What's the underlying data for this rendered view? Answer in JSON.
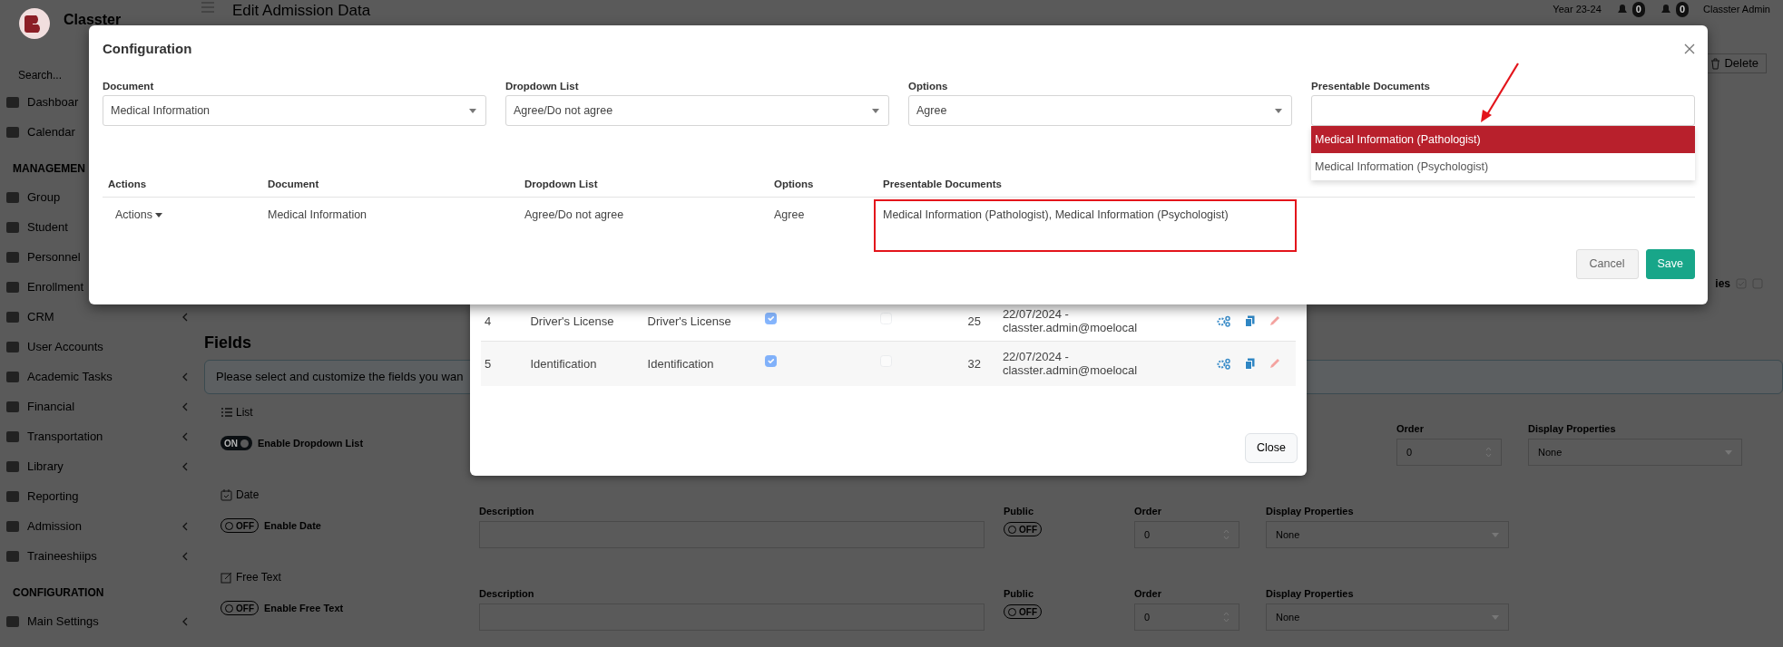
{
  "app": {
    "logo_text": "Classter",
    "search_placeholder": "Search...",
    "page_title": "Edit Admission Data",
    "year": "Year 23-24",
    "notification_counts": [
      "0",
      "0"
    ],
    "user": "Classter Admin",
    "delete_label": "Delete",
    "cut_label": "ies"
  },
  "sidebar": {
    "items": [
      {
        "kind": "item",
        "label": "Dashboar",
        "submenu": false
      },
      {
        "kind": "item",
        "label": "Calendar",
        "submenu": false
      },
      {
        "kind": "heading",
        "label": "MANAGEMEN"
      },
      {
        "kind": "item",
        "label": "Group",
        "submenu": false
      },
      {
        "kind": "item",
        "label": "Student",
        "submenu": false
      },
      {
        "kind": "item",
        "label": "Personnel",
        "submenu": false
      },
      {
        "kind": "item",
        "label": "Enrollment",
        "submenu": false
      },
      {
        "kind": "item",
        "label": "CRM",
        "submenu": true
      },
      {
        "kind": "item",
        "label": "User Accounts",
        "submenu": false
      },
      {
        "kind": "item",
        "label": "Academic Tasks",
        "submenu": true
      },
      {
        "kind": "item",
        "label": "Financial",
        "submenu": true
      },
      {
        "kind": "item",
        "label": "Transportation",
        "submenu": true
      },
      {
        "kind": "item",
        "label": "Library",
        "submenu": true
      },
      {
        "kind": "item",
        "label": "Reporting",
        "submenu": false
      },
      {
        "kind": "item",
        "label": "Admission",
        "submenu": true
      },
      {
        "kind": "item",
        "label": "Traineeshiips",
        "submenu": true
      },
      {
        "kind": "heading",
        "label": "CONFIGURATION"
      },
      {
        "kind": "item",
        "label": "Main Settings",
        "submenu": true
      }
    ]
  },
  "fields_page": {
    "title": "Fields",
    "notice": "Please select and customize the fields you wan",
    "sections": [
      {
        "kind": "list",
        "title": "List",
        "toggle_on": true,
        "toggle_text": "ON",
        "toggle_label": "Enable Dropdown List",
        "order_label": "Order",
        "order_value": "0",
        "display_label": "Display Properties",
        "display_value": "None"
      },
      {
        "kind": "date",
        "title": "Date",
        "toggle_on": false,
        "toggle_text": "OFF",
        "toggle_label": "Enable Date",
        "description_label": "Description",
        "public_label": "Public",
        "public_on": false,
        "public_text": "OFF",
        "order_label": "Order",
        "order_value": "0",
        "display_label": "Display Properties",
        "display_value": "None"
      },
      {
        "kind": "text",
        "title": "Free Text",
        "toggle_on": false,
        "toggle_text": "OFF",
        "toggle_label": "Enable Free Text",
        "description_label": "Description",
        "public_label": "Public",
        "public_on": false,
        "public_text": "OFF",
        "order_label": "Order",
        "order_value": "0",
        "display_label": "Display Properties",
        "display_value": "None"
      }
    ]
  },
  "documents_modal": {
    "rows": [
      {
        "column_1": "4",
        "column_2": "Driver's License",
        "column_3": "Driver's License",
        "column_4_checked": true,
        "column_5_checked": false,
        "column_6": "25",
        "column_7": "22/07/2024 - classter.admin@moelocal"
      },
      {
        "column_1": "5",
        "column_2": "Identification",
        "column_3": "Identification",
        "column_4_checked": true,
        "column_5_checked": false,
        "column_6": "32",
        "column_7": "22/07/2024 - classter.admin@moelocal"
      }
    ],
    "close_label": "Close"
  },
  "configuration_modal": {
    "title": "Configuration",
    "fields": [
      {
        "label": "Document",
        "value": "Medical Information",
        "open": false
      },
      {
        "label": "Dropdown List",
        "value": "Agree/Do not agree",
        "open": false
      },
      {
        "label": "Options",
        "value": "Agree",
        "open": false
      },
      {
        "label": "Presentable Documents",
        "open": true,
        "arrow_annotation": true,
        "options": [
          {
            "label": "Medical Information (Pathologist)",
            "selected": true
          },
          {
            "label": "Medical Information (Psychologist)",
            "selected": false
          }
        ]
      }
    ],
    "table": {
      "columns": [
        "Actions",
        "Document",
        "Dropdown List",
        "Options",
        "Presentable Documents"
      ],
      "rows": [
        {
          "actions": "Actions",
          "document": "Medical Information",
          "dropdown_list": "Agree/Do not agree",
          "options": "Agree",
          "presentable_documents": "Medical Information (Pathologist), Medical Information (Psychologist)",
          "highlighted": true
        }
      ]
    },
    "buttons": [
      {
        "label": "Cancel",
        "kind": "secondary"
      },
      {
        "label": "Save",
        "kind": "primary"
      }
    ]
  }
}
